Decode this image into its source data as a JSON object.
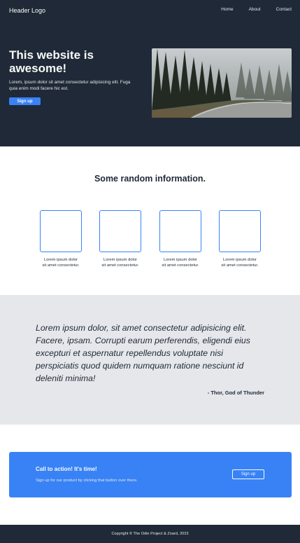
{
  "header": {
    "logo": "Header Logo",
    "nav": [
      "Home",
      "About",
      "Contact"
    ]
  },
  "hero": {
    "title": "This website is awesome!",
    "subtitle": "Lorem, ipsum dolor sit amet consectetur adipisicing elit. Fuga quia enim modi facere hic est.",
    "button": "Sign up",
    "image": "forest-road-image"
  },
  "info": {
    "title": "Some random information.",
    "cards": [
      {
        "line1": "Lorem ipsum dolor",
        "line2": "sit amet consectetur."
      },
      {
        "line1": "Lorem ipsum dolor",
        "line2": "sit amet consectetur."
      },
      {
        "line1": "Lorem ipsum dolor",
        "line2": "sit amet consectetur."
      },
      {
        "line1": "Lorem ipsum dolor",
        "line2": "sit amet consectetur."
      }
    ]
  },
  "quote": {
    "text": "Lorem ipsum dolor, sit amet consectetur adipisicing elit. Facere, ipsam. Corrupti earum perferendis, eligendi eius excepturi et aspernatur repellendus voluptate nisi perspiciatis quod quidem numquam ratione nesciunt id deleniti minima!",
    "author": "- Thor, God of Thunder"
  },
  "cta": {
    "title": "Call to action! It's time!",
    "subtitle": "Sign up for our product by clicking that button over there.",
    "button": "Sign up"
  },
  "footer": {
    "text": "Copyright © The Odin Project & Zoard, 2023"
  },
  "colors": {
    "dark": "#1f2937",
    "accent": "#3882f6",
    "light_gray": "#e5e7eb",
    "off_white": "#f9faf8"
  }
}
